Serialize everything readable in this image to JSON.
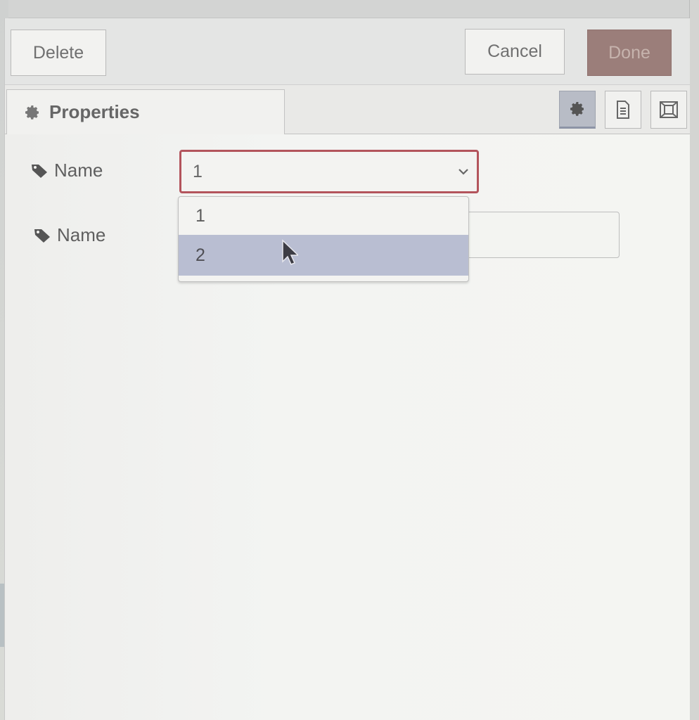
{
  "toolbar": {
    "delete_label": "Delete",
    "cancel_label": "Cancel",
    "done_label": "Done"
  },
  "tabs": {
    "properties_label": "Properties",
    "icons": [
      "gear-icon",
      "document-icon",
      "frame-icon"
    ]
  },
  "form": {
    "field1_label": "Name",
    "field1_selected": "1",
    "field1_options": [
      "1",
      "2"
    ],
    "field1_highlighted_option": "2",
    "field2_label": "Name",
    "field2_value": ""
  },
  "colors": {
    "done_button": "#9b7e7a",
    "select_focus_border": "#b3545c",
    "option_highlight": "#b9bed2"
  }
}
